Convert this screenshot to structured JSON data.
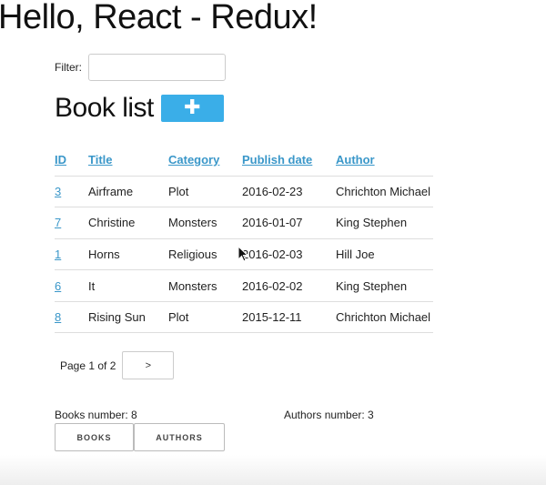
{
  "app": {
    "heading": "Hello, React - Redux!"
  },
  "filter": {
    "label": "Filter:",
    "value": "",
    "placeholder": ""
  },
  "book_list": {
    "title": "Book list",
    "add_icon": "plus-icon",
    "add_glyph": "✚"
  },
  "table": {
    "headers": {
      "id": "ID",
      "title": "Title",
      "category": "Category",
      "publish_date": "Publish date",
      "author": "Author"
    },
    "rows": [
      {
        "id": "3",
        "title": "Airframe",
        "category": "Plot",
        "publish_date": "2016-02-23",
        "author": "Chrichton Michael"
      },
      {
        "id": "7",
        "title": "Christine",
        "category": "Monsters",
        "publish_date": "2016-01-07",
        "author": "King Stephen"
      },
      {
        "id": "1",
        "title": "Horns",
        "category": "Religious",
        "publish_date": "2016-02-03",
        "author": "Hill Joe"
      },
      {
        "id": "6",
        "title": "It",
        "category": "Monsters",
        "publish_date": "2016-02-02",
        "author": "King Stephen"
      },
      {
        "id": "8",
        "title": "Rising Sun",
        "category": "Plot",
        "publish_date": "2015-12-11",
        "author": "Chrichton Michael"
      }
    ]
  },
  "pager": {
    "text": "Page 1 of 2",
    "next_label": ">"
  },
  "stats": {
    "books": "Books number: 8",
    "authors": "Authors number: 3"
  },
  "nav": {
    "books_label": "BOOKS",
    "authors_label": "AUTHORS"
  },
  "colors": {
    "accent": "#3aaee8",
    "link": "#3a97c9",
    "border": "#dddddd"
  }
}
